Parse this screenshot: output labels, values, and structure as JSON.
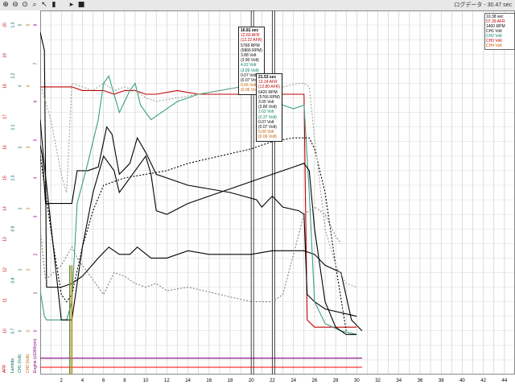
{
  "toolbar": {
    "buttons": [
      "zoom-in",
      "zoom-out",
      "zoom-reset",
      "zoom-box",
      "cursor",
      "marker",
      "play",
      "stop"
    ],
    "title": "ログデータ - 30.47 sec"
  },
  "legend": {
    "title": "10.38 sec",
    "items": [
      {
        "label": "07.39 AFR",
        "color": "#c00000"
      },
      {
        "label": "1400 RPM",
        "color": "#000000"
      },
      {
        "label": "CH1 Volt",
        "color": "#000000"
      },
      {
        "label": "CH2 Volt",
        "color": "#008060"
      },
      {
        "label": "CH3 Volt",
        "color": "#c00000"
      },
      {
        "label": "CH4 Volt",
        "color": "#c06000"
      }
    ]
  },
  "readouts": [
    {
      "lines": [
        "16.81 sec",
        "12.60 AFR",
        "(12.22 AFR)",
        "5768 RPM",
        "(5866 RPM)",
        "3.88 Volt",
        "(3.90 Volt)",
        "4.02 Volt",
        "(3.99 Volt)",
        "0.07 Volt",
        "(0.07 Volt)",
        "0.06 Volt",
        "(0.06 Volt)"
      ]
    },
    {
      "lines": [
        "21.53 sec",
        "13.24 AFR",
        "(12.80 AFR)",
        "6420 RPM",
        "(5766 RPM)",
        "3.05 Volt",
        "(3.80 Volt)",
        "2.62 Volt",
        "(2.37 Volt)",
        "0.07 Volt",
        "(0.07 Volt)",
        "0.00 Volt",
        "(0.06 Volt)"
      ]
    }
  ],
  "axes": {
    "columns": [
      {
        "name": "AFR",
        "color": "#c00000",
        "ticks": [
          "10",
          "11",
          "12",
          "13",
          "14",
          "15",
          "16",
          "17",
          "18",
          "19",
          "20"
        ]
      },
      {
        "name": "Lambda",
        "color": "#006060",
        "ticks": [
          "0.7",
          "0.8",
          "0.9",
          "1.0",
          "1.1",
          "1.2",
          "1.3"
        ]
      },
      {
        "name": "CH1 (Volt)",
        "color": "#008060",
        "ticks": [
          "0",
          "1",
          "2",
          "3",
          "4",
          "5"
        ]
      },
      {
        "name": "CH2 (Volt)",
        "color": "#c06000",
        "ticks": [
          "0",
          "1",
          "2",
          "3",
          "4",
          "5"
        ]
      },
      {
        "name": "Engine (x1000rpm)",
        "color": "#800080",
        "ticks": [
          "0",
          "1",
          "2",
          "3",
          "4",
          "5",
          "6",
          "7",
          "8"
        ]
      }
    ]
  },
  "chart_data": {
    "type": "line",
    "xlim": [
      0,
      45
    ],
    "x_ticks": [
      2,
      4,
      6,
      8,
      10,
      12,
      14,
      16,
      18,
      20,
      22,
      24,
      26,
      28,
      30,
      32,
      34,
      36,
      38,
      40,
      42,
      44
    ],
    "ylim": [
      0,
      100
    ],
    "grid": true,
    "cursors": [
      20,
      22
    ],
    "series": [
      {
        "color": "#c00000",
        "dash": false,
        "x": [
          0,
          0.2,
          2.5,
          3.0,
          4.0,
          5.0,
          6.0,
          7.0,
          8.0,
          9.0,
          10.0,
          11.0,
          13.0,
          15.0,
          17.0,
          19.0,
          21.0,
          23.0,
          25.0,
          25.3,
          26.0,
          27.0,
          28.0,
          30.0
        ],
        "y": [
          79,
          79,
          79,
          79,
          78,
          78,
          78,
          77,
          78,
          78,
          77,
          77,
          78,
          77,
          77,
          77,
          77,
          77,
          77,
          15,
          13,
          13,
          13,
          13
        ]
      },
      {
        "color": "#000000",
        "dash": false,
        "x": [
          0,
          0.2,
          0.5,
          2.0,
          3.0,
          3.5,
          4.5,
          5.5,
          6.3,
          6.8,
          7.5,
          8.5,
          9.2,
          10.0,
          11.0,
          14.0,
          18.0,
          20.5,
          21.0,
          22.0,
          23.0,
          24.5,
          25.0,
          25.3,
          26.0,
          27.0,
          30.0
        ],
        "y": [
          63,
          60,
          47,
          47,
          47,
          56,
          56,
          57,
          68,
          66,
          55,
          58,
          65,
          61,
          55,
          52,
          50,
          48,
          46,
          49,
          46,
          45,
          44,
          22,
          20,
          18,
          16
        ]
      },
      {
        "color": "#000000",
        "dash": false,
        "x": [
          0,
          0.4,
          0.6,
          2.0,
          3.0,
          4.0,
          5.5,
          6.5,
          7.5,
          8.5,
          9.2,
          10.5,
          12.0,
          14.0,
          16.0,
          18.0,
          20.0,
          22.0,
          25.0,
          26.0,
          27.0,
          28.5,
          29.5,
          30.5
        ],
        "y": [
          94,
          89,
          24,
          24,
          25,
          27,
          32,
          35,
          33,
          33,
          35,
          32,
          32,
          34,
          33,
          33,
          33,
          34,
          34,
          33,
          30,
          28,
          15,
          12
        ]
      },
      {
        "color": "#3b9e86",
        "dash": false,
        "x": [
          0,
          0.4,
          0.6,
          1.5,
          2.5,
          3.0,
          3.5,
          4.5,
          5.5,
          6.0,
          6.5,
          7.5,
          8.5,
          9.0,
          9.5,
          10.5,
          11.5,
          13.0,
          15.0,
          17.0,
          19.0,
          20.0,
          20.5,
          21.0,
          22.0,
          23.0,
          24.0,
          25.0,
          25.5,
          26.0,
          27.0,
          28.5,
          30.0
        ],
        "y": [
          23,
          16,
          15,
          15,
          15,
          20,
          47,
          58,
          70,
          80,
          82,
          72,
          78,
          80,
          74,
          70,
          72,
          75,
          77,
          78,
          79,
          80,
          78,
          74,
          76,
          74,
          73,
          74,
          50,
          20,
          14,
          12,
          11
        ]
      },
      {
        "color": "#000000",
        "dash": false,
        "x": [
          0,
          0.3,
          2.0,
          3.0,
          4.0,
          5.0,
          6.0,
          7.0,
          7.5,
          8.5,
          9.5,
          10.0,
          10.5,
          11.0,
          12.0,
          14.0,
          16.0,
          18.0,
          20.0,
          22.0,
          24.0,
          25.0,
          25.5,
          26.0,
          27.0,
          28.0,
          29.0,
          30.0
        ],
        "y": [
          70,
          60,
          15,
          15,
          35,
          50,
          60,
          56,
          50,
          54,
          58,
          60,
          55,
          45,
          44,
          47,
          49,
          51,
          53,
          55,
          57,
          58,
          56,
          40,
          20,
          13,
          11,
          11
        ]
      },
      {
        "color": "#808080",
        "dash": true,
        "x": [
          0,
          0.5,
          2.0,
          3.0,
          3.5,
          4.5,
          5.5,
          6.0,
          6.5,
          7.0,
          8.0,
          9.0,
          10.0,
          11.0,
          12.0,
          14.0,
          17.0,
          20.0,
          22.0,
          23.0,
          25.0,
          26.0,
          27.0,
          28.0,
          28.5
        ],
        "y": [
          40,
          26,
          30,
          35,
          32,
          28,
          24,
          22,
          25,
          28,
          27,
          25,
          24,
          25,
          23,
          24,
          22,
          20,
          20,
          22,
          44,
          46,
          44,
          38,
          36
        ]
      },
      {
        "color": "#000000",
        "dash": true,
        "x": [
          0,
          1.0,
          2.0,
          2.5,
          3.0,
          4.0,
          5.0,
          6.0,
          8.0,
          10.0,
          12.0,
          14.0,
          17.0,
          20.0,
          22.0,
          24.0,
          25.5,
          26.0,
          27.0,
          28.0,
          29.0
        ],
        "y": [
          60,
          40,
          22,
          20,
          22,
          35,
          45,
          52,
          54,
          55,
          56,
          58,
          60,
          62,
          64,
          65,
          65,
          62,
          50,
          30,
          12
        ]
      },
      {
        "color": "#9aa890",
        "dash": true,
        "x": [
          0,
          1.0,
          2.0,
          2.5,
          3.0,
          4.0,
          5.0,
          6.0,
          7.0,
          8.0,
          9.0,
          10.0,
          11.0,
          13.0,
          15.0,
          17.0,
          19.0,
          21.0,
          23.0,
          24.5,
          25.0,
          25.5,
          26.0,
          27.0,
          28.0,
          29.0,
          30.0
        ],
        "y": [
          80,
          70,
          55,
          50,
          80,
          79,
          78,
          80,
          78,
          79,
          78,
          76,
          75,
          76,
          77,
          78,
          79,
          78,
          79,
          80,
          80,
          79,
          65,
          40,
          30,
          25,
          24
        ]
      },
      {
        "color": "#800080",
        "dash": false,
        "x": [
          0,
          30.5
        ],
        "y": [
          4.5,
          4.5
        ]
      },
      {
        "color": "#ff0000",
        "dash": false,
        "x": [
          0,
          30.5
        ],
        "y": [
          2,
          2
        ]
      }
    ],
    "spikes": [
      {
        "x": 2.8,
        "color": "#5a9040"
      },
      {
        "x": 3.0,
        "color": "#c08000"
      }
    ]
  }
}
